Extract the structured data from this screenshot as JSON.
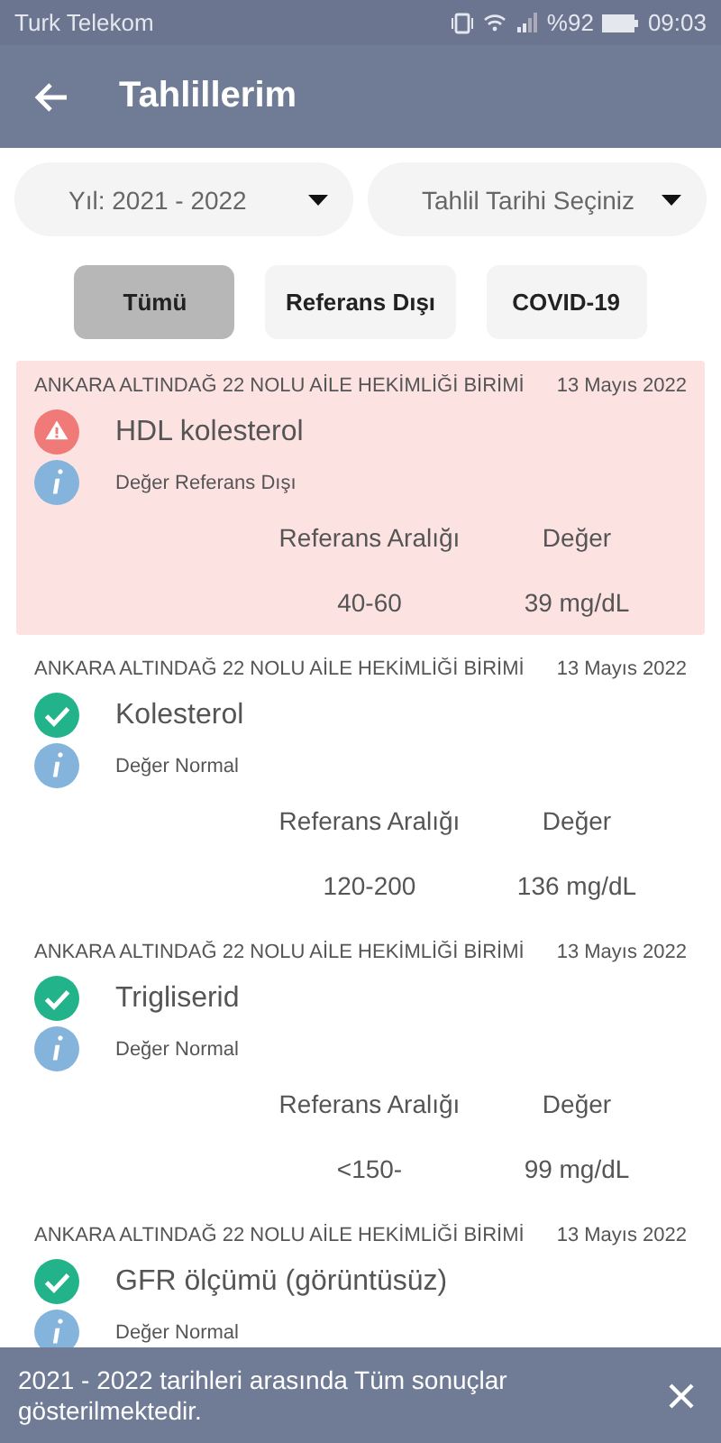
{
  "status_bar": {
    "carrier": "Turk Telekom",
    "battery": "%92",
    "time": "09:03"
  },
  "header": {
    "title": "Tahlillerim"
  },
  "filters": [
    {
      "label": "Yıl: 2021 - 2022"
    },
    {
      "label": "Tahlil Tarihi Seçiniz"
    }
  ],
  "tabs": [
    {
      "label": "Tümü",
      "selected": true
    },
    {
      "label": "Referans Dışı",
      "selected": false
    },
    {
      "label": "COVID-19",
      "selected": false
    }
  ],
  "results": [
    {
      "kind": "abnormal",
      "clinic": "ANKARA ALTINDAĞ 22 NOLU AİLE HEKİMLİĞİ BİRİMİ",
      "date": "13 Mayıs 2022",
      "name": "HDL kolesterol",
      "note": "Değer Referans Dışı",
      "range_label": "Referans Aralığı",
      "value_label": "Değer",
      "range": "40-60",
      "value": "39 mg/dL"
    },
    {
      "kind": "normal",
      "clinic": "ANKARA ALTINDAĞ 22 NOLU AİLE HEKİMLİĞİ BİRİMİ",
      "date": "13 Mayıs 2022",
      "name": "Kolesterol",
      "note": "Değer Normal",
      "range_label": "Referans Aralığı",
      "value_label": "Değer",
      "range": "120-200",
      "value": "136 mg/dL"
    },
    {
      "kind": "normal",
      "clinic": "ANKARA ALTINDAĞ 22 NOLU AİLE HEKİMLİĞİ BİRİMİ",
      "date": "13 Mayıs 2022",
      "name": "Trigliserid",
      "note": "Değer Normal",
      "range_label": "Referans Aralığı",
      "value_label": "Değer",
      "range": "<150-",
      "value": "99 mg/dL"
    },
    {
      "kind": "normal",
      "clinic": "ANKARA ALTINDAĞ 22 NOLU AİLE HEKİMLİĞİ BİRİMİ",
      "date": "13 Mayıs 2022",
      "name": "GFR ölçümü (görüntüsüz)",
      "note": "Değer Normal"
    }
  ],
  "snackbar": {
    "message": "2021 - 2022 tarihleri arasında Tüm sonuçlar gösterilmektedir."
  }
}
